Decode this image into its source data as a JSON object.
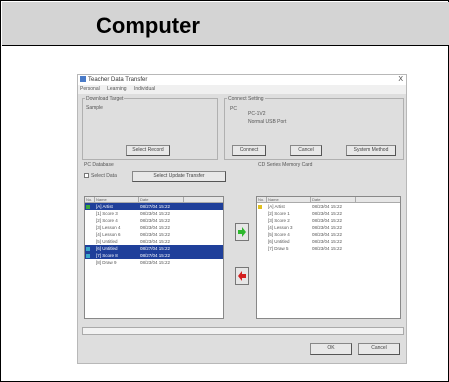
{
  "header": {
    "title": "Computer"
  },
  "dialog": {
    "title": "Teacher Data Transfer",
    "close_glyph": "X",
    "menu": [
      "Personal",
      "Learning",
      "Individual"
    ],
    "download_group": {
      "label": "Download Target",
      "value": "Sample"
    },
    "connect_group": {
      "label": "Connect Setting",
      "lines": [
        "PC",
        "PC-1V2",
        "Normal USB Port"
      ]
    },
    "buttons": {
      "select_path": "Select Record",
      "connect": "Connect",
      "cancel": "Cancel",
      "system_method": "System Method",
      "select_update": "Select Update Transfer",
      "ok": "OK",
      "cancel_bottom": "Cancel"
    },
    "left_panel": {
      "label": "PC Database",
      "checkbox_label": "Select Data",
      "columns": [
        "No.",
        "Name",
        "Date"
      ],
      "rows": [
        {
          "no": "",
          "name": "[A] Artist",
          "date": "08/27/04 15:22",
          "selected": true
        },
        {
          "no": "",
          "name": "[1] Score 3",
          "date": "08/23/04 15:22",
          "selected": false
        },
        {
          "no": "",
          "name": "[2] Score 4",
          "date": "08/23/04 15:22",
          "selected": false
        },
        {
          "no": "",
          "name": "[3] Lesson 4",
          "date": "08/23/04 15:22",
          "selected": false
        },
        {
          "no": "",
          "name": "[4] Lesson 6",
          "date": "08/23/04 15:22",
          "selected": false
        },
        {
          "no": "",
          "name": "[5] Untitled",
          "date": "08/23/04 15:22",
          "selected": false
        },
        {
          "no": "",
          "name": "[6] Untitled",
          "date": "08/27/04 15:22",
          "selected": true
        },
        {
          "no": "",
          "name": "[7] Score 8",
          "date": "08/27/04 15:22",
          "selected": true
        },
        {
          "no": "",
          "name": "[8] Draw 9",
          "date": "08/23/04 15:22",
          "selected": false
        }
      ]
    },
    "right_panel": {
      "label": "CD Series Memory Card",
      "columns": [
        "No.",
        "Name",
        "Date"
      ],
      "rows": [
        {
          "no": "",
          "name": "[A] Artist",
          "date": "08/23/04 15:22"
        },
        {
          "no": "",
          "name": "[2] Score 1",
          "date": "08/23/04 15:22"
        },
        {
          "no": "",
          "name": "[3] Score 2",
          "date": "08/23/04 15:22"
        },
        {
          "no": "",
          "name": "[4] Lesson 3",
          "date": "08/23/04 15:22"
        },
        {
          "no": "",
          "name": "[5] Score 4",
          "date": "08/23/04 15:22"
        },
        {
          "no": "",
          "name": "[6] Untitled",
          "date": "08/23/04 15:22"
        },
        {
          "no": "",
          "name": "[7] Draw 5",
          "date": "08/23/04 15:22"
        }
      ]
    },
    "colors": {
      "selection": "#1f3f9a",
      "green_arrow": "#2db82d",
      "red_arrow": "#d42020"
    }
  }
}
